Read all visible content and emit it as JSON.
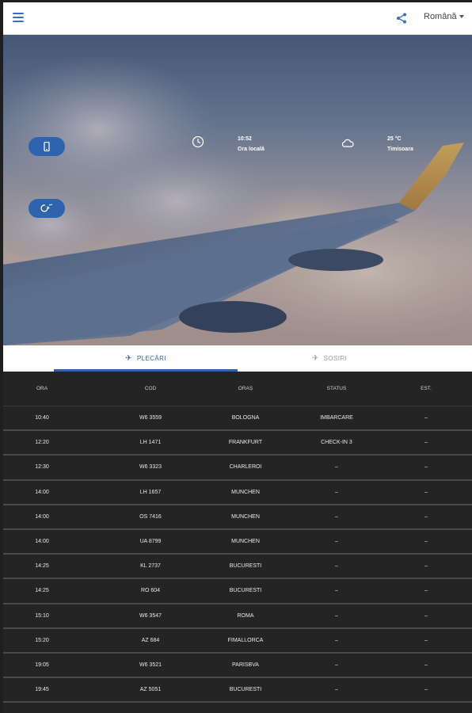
{
  "header": {
    "menu_icon": "hamburger-menu-icon",
    "share_icon": "share-icon",
    "language": "Română"
  },
  "hero": {
    "time": {
      "value": "10:52",
      "label": "Ora locală",
      "icon": "clock-icon"
    },
    "weather": {
      "value": "25 °C",
      "label": "Timisoara",
      "icon": "cloud-icon"
    },
    "buttons": [
      {
        "icon": "mobile-phone-icon"
      },
      {
        "icon": "refresh-plane-icon"
      }
    ]
  },
  "tabs": [
    {
      "label": "PLECĂRI",
      "icon": "takeoff-icon",
      "active": true
    },
    {
      "label": "SOSIRI",
      "icon": "landing-icon",
      "active": false
    }
  ],
  "table": {
    "columns": [
      "ORA",
      "COD",
      "ORAȘ",
      "STATUS",
      "EST."
    ],
    "rows": [
      [
        "10:40",
        "W6 3559",
        "BOLOGNA",
        "IMBARCARE",
        "–"
      ],
      [
        "12:20",
        "LH 1471",
        "FRANKFURT",
        "CHECK-IN 3",
        "–"
      ],
      [
        "12:30",
        "W6 3323",
        "CHARLEROI",
        "–",
        "–"
      ],
      [
        "14:00",
        "LH 1657",
        "MUNCHEN",
        "–",
        "–"
      ],
      [
        "14:00",
        "OS 7416",
        "MUNCHEN",
        "–",
        "–"
      ],
      [
        "14:00",
        "UA 8799",
        "MUNCHEN",
        "–",
        "–"
      ],
      [
        "14:25",
        "KL 2737",
        "BUCURESTI",
        "–",
        "–"
      ],
      [
        "14:25",
        "RO 604",
        "BUCURESTI",
        "–",
        "–"
      ],
      [
        "15:10",
        "W6 3547",
        "ROMA",
        "–",
        "–"
      ],
      [
        "15:20",
        "AZ 684",
        "FIMALLORCA",
        "–",
        "–"
      ],
      [
        "19:05",
        "W6 3521",
        "PARISBVA",
        "–",
        "–"
      ],
      [
        "19:45",
        "AZ 5051",
        "BUCURESTI",
        "–",
        "–"
      ]
    ]
  },
  "colors": {
    "accent": "#2e63b0",
    "board_bg": "#242424",
    "row_divider": "#4a4a4a"
  }
}
